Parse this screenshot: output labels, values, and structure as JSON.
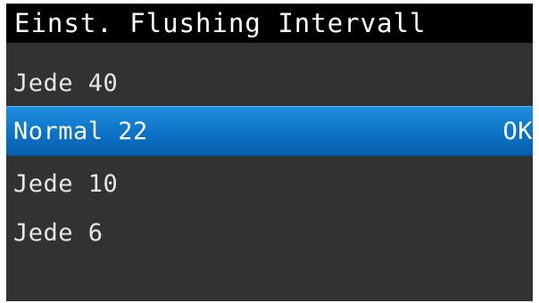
{
  "title": "Einst. Flushing Intervall",
  "menu": {
    "items": [
      {
        "label": "Jede 40"
      },
      {
        "label": "Normal 22",
        "selected": true,
        "ok_label": "OK"
      },
      {
        "label": "Jede 10"
      },
      {
        "label": "Jede 6"
      }
    ]
  },
  "colors": {
    "screen_background": "#323232",
    "title_background": "#000000",
    "selection_highlight": "#0b72c6",
    "text": "#e6e6e6"
  }
}
